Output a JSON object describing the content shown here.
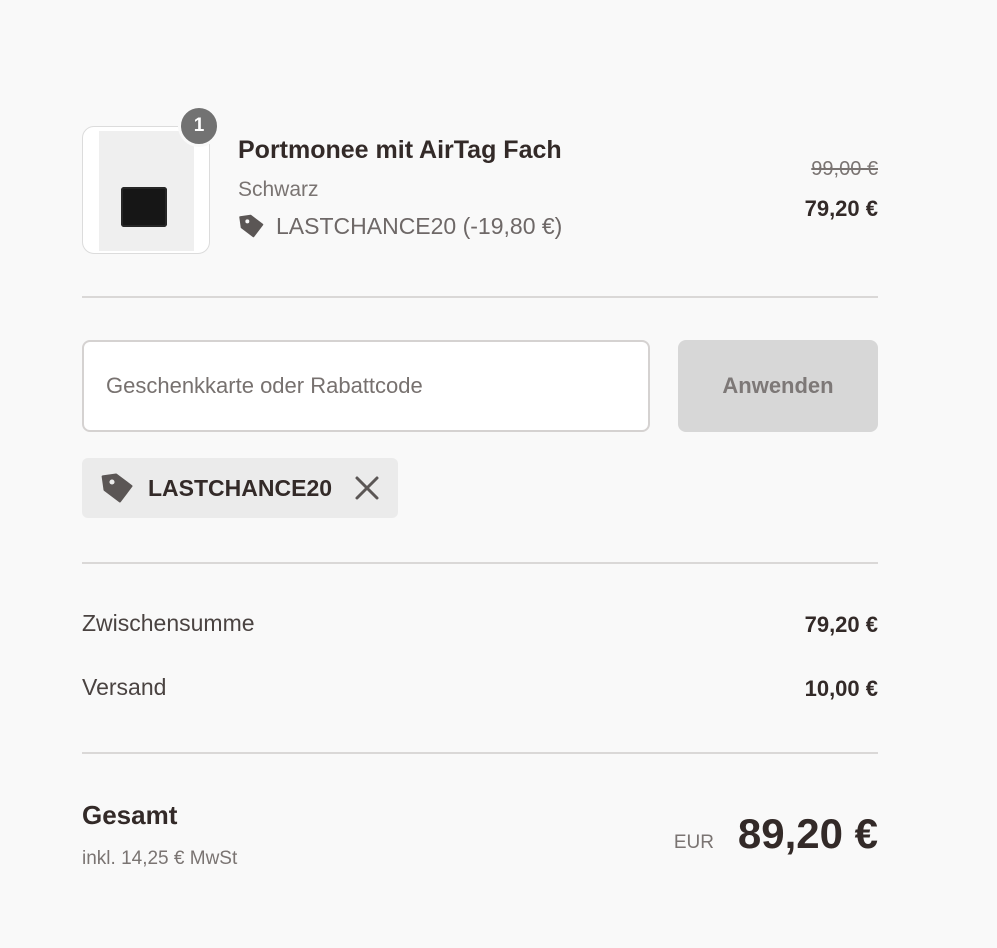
{
  "cart": {
    "item": {
      "quantity": "1",
      "title": "Portmonee mit AirTag Fach",
      "variant": "Schwarz",
      "discount_line": "LASTCHANCE20 (-19,80 €)",
      "compare_price": "99,00 €",
      "price": "79,20 €",
      "image_icon": "wallet-product-image"
    }
  },
  "discount_form": {
    "input_value": "",
    "placeholder": "Geschenkkarte oder Rabattcode",
    "apply_label": "Anwenden"
  },
  "applied_code": {
    "label": "LASTCHANCE20",
    "tag_icon": "tag-icon",
    "remove_icon": "close-icon"
  },
  "summary": {
    "subtotal_label": "Zwischensumme",
    "subtotal_value": "79,20 €",
    "shipping_label": "Versand",
    "shipping_value": "10,00 €",
    "total_label": "Gesamt",
    "tax_note": "inkl. 14,25 € MwSt",
    "currency": "EUR",
    "total_value": "89,20 €"
  },
  "colors": {
    "background": "#f9f9f9",
    "text": "#332a28",
    "muted_text": "#7a7472",
    "badge": "#727272",
    "button_disabled": "#d7d7d7",
    "chip_background": "#ebebeb"
  }
}
